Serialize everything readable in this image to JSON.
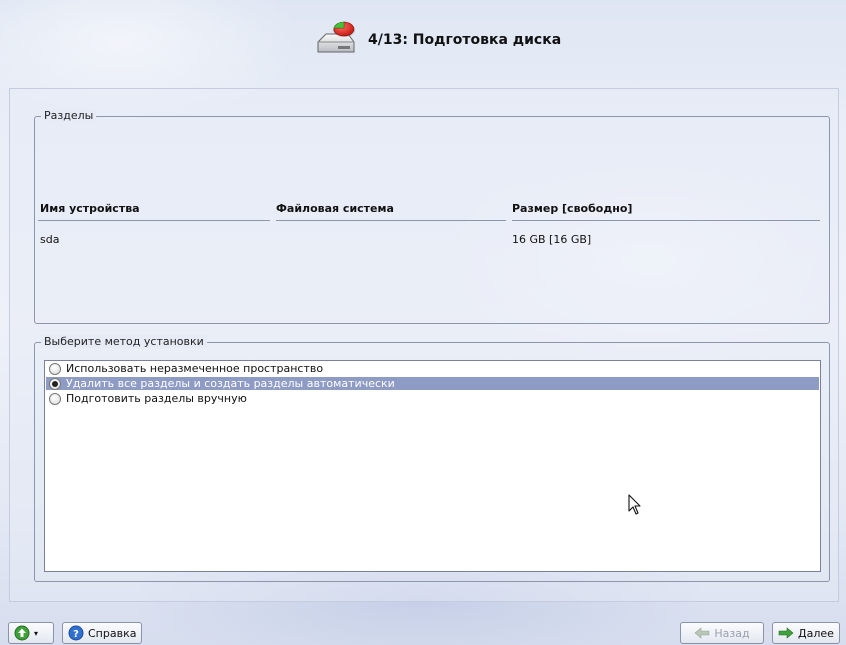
{
  "header": {
    "title": "4/13: Подготовка диска",
    "icon": "disk-partition-icon"
  },
  "partitions": {
    "group_title": "Разделы",
    "columns": [
      "Имя устройства",
      "Файловая система",
      "Размер [свободно]"
    ],
    "rows": [
      {
        "device": "sda",
        "filesystem": "",
        "size": "16 GB [16 GB]"
      }
    ]
  },
  "methods": {
    "group_title": "Выберите метод установки",
    "options": [
      {
        "label": "Использовать неразмеченное пространство",
        "selected": false
      },
      {
        "label": "Удалить все разделы и создать разделы автоматически",
        "selected": true
      },
      {
        "label": "Подготовить разделы вручную",
        "selected": false
      }
    ]
  },
  "footer": {
    "menu_icon": "green-arrow-up-icon",
    "help_label": "Справка",
    "back_label": "Назад",
    "next_label": "Далее"
  },
  "colors": {
    "selection": "#8e9bc4",
    "accent_green": "#3fa13a",
    "help_blue": "#2f6fd0"
  }
}
